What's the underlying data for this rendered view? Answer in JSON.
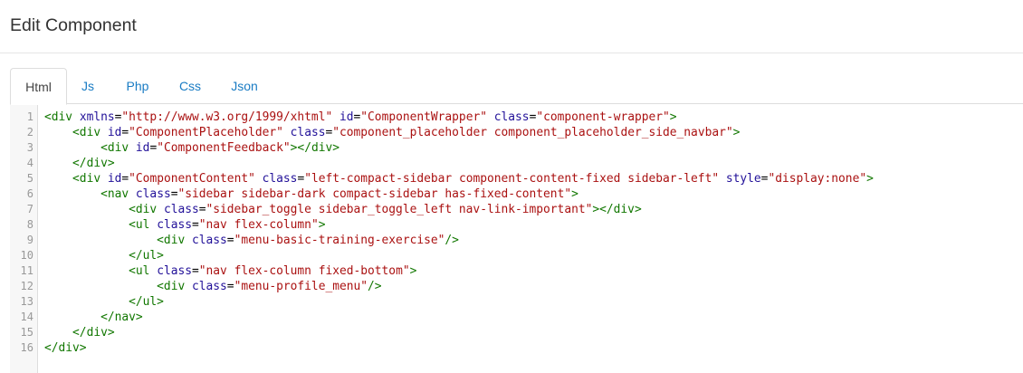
{
  "header": {
    "title": "Edit Component"
  },
  "tabs": [
    {
      "label": "Html",
      "active": true
    },
    {
      "label": "Js",
      "active": false
    },
    {
      "label": "Php",
      "active": false
    },
    {
      "label": "Css",
      "active": false
    },
    {
      "label": "Json",
      "active": false
    }
  ],
  "editor": {
    "line_numbers": [
      "1",
      "2",
      "3",
      "4",
      "5",
      "6",
      "7",
      "8",
      "9",
      "10",
      "11",
      "12",
      "13",
      "14",
      "15",
      "16"
    ],
    "lines": [
      [
        [
          "tag",
          "<div "
        ],
        [
          "attr",
          "xmlns"
        ],
        [
          "punct",
          "="
        ],
        [
          "str",
          "\"http://www.w3.org/1999/xhtml\""
        ],
        [
          "punct",
          " "
        ],
        [
          "attr",
          "id"
        ],
        [
          "punct",
          "="
        ],
        [
          "str",
          "\"ComponentWrapper\""
        ],
        [
          "punct",
          " "
        ],
        [
          "attr",
          "class"
        ],
        [
          "punct",
          "="
        ],
        [
          "str",
          "\"component-wrapper\""
        ],
        [
          "tag",
          ">"
        ]
      ],
      [
        [
          "tag",
          "    <div "
        ],
        [
          "attr",
          "id"
        ],
        [
          "punct",
          "="
        ],
        [
          "str",
          "\"ComponentPlaceholder\""
        ],
        [
          "punct",
          " "
        ],
        [
          "attr",
          "class"
        ],
        [
          "punct",
          "="
        ],
        [
          "str",
          "\"component_placeholder component_placeholder_side_navbar\""
        ],
        [
          "tag",
          ">"
        ]
      ],
      [
        [
          "tag",
          "        <div "
        ],
        [
          "attr",
          "id"
        ],
        [
          "punct",
          "="
        ],
        [
          "str",
          "\"ComponentFeedback\""
        ],
        [
          "tag",
          "></div>"
        ]
      ],
      [
        [
          "tag",
          "    </div>"
        ]
      ],
      [
        [
          "tag",
          "    <div "
        ],
        [
          "attr",
          "id"
        ],
        [
          "punct",
          "="
        ],
        [
          "str",
          "\"ComponentContent\""
        ],
        [
          "punct",
          " "
        ],
        [
          "attr",
          "class"
        ],
        [
          "punct",
          "="
        ],
        [
          "str",
          "\"left-compact-sidebar component-content-fixed sidebar-left\""
        ],
        [
          "punct",
          " "
        ],
        [
          "attr",
          "style"
        ],
        [
          "punct",
          "="
        ],
        [
          "str",
          "\"display:none\""
        ],
        [
          "tag",
          ">"
        ]
      ],
      [
        [
          "tag",
          "        <nav "
        ],
        [
          "attr",
          "class"
        ],
        [
          "punct",
          "="
        ],
        [
          "str",
          "\"sidebar sidebar-dark compact-sidebar has-fixed-content\""
        ],
        [
          "tag",
          ">"
        ]
      ],
      [
        [
          "tag",
          "            <div "
        ],
        [
          "attr",
          "class"
        ],
        [
          "punct",
          "="
        ],
        [
          "str",
          "\"sidebar_toggle sidebar_toggle_left nav-link-important\""
        ],
        [
          "tag",
          "></div>"
        ]
      ],
      [
        [
          "tag",
          "            <ul "
        ],
        [
          "attr",
          "class"
        ],
        [
          "punct",
          "="
        ],
        [
          "str",
          "\"nav flex-column\""
        ],
        [
          "tag",
          ">"
        ]
      ],
      [
        [
          "tag",
          "                <div "
        ],
        [
          "attr",
          "class"
        ],
        [
          "punct",
          "="
        ],
        [
          "str",
          "\"menu-basic-training-exercise\""
        ],
        [
          "tag",
          "/>"
        ]
      ],
      [
        [
          "tag",
          "            </ul>"
        ]
      ],
      [
        [
          "tag",
          "            <ul "
        ],
        [
          "attr",
          "class"
        ],
        [
          "punct",
          "="
        ],
        [
          "str",
          "\"nav flex-column fixed-bottom\""
        ],
        [
          "tag",
          ">"
        ]
      ],
      [
        [
          "tag",
          "                <div "
        ],
        [
          "attr",
          "class"
        ],
        [
          "punct",
          "="
        ],
        [
          "str",
          "\"menu-profile_menu\""
        ],
        [
          "tag",
          "/>"
        ]
      ],
      [
        [
          "tag",
          "            </ul>"
        ]
      ],
      [
        [
          "tag",
          "        </nav>"
        ]
      ],
      [
        [
          "tag",
          "    </div>"
        ]
      ],
      [
        [
          "tag",
          "</div>"
        ]
      ]
    ]
  },
  "colors": {
    "tag": "#117700",
    "attr": "#221199",
    "string": "#aa1111",
    "tab_link": "#1a7cc4"
  }
}
